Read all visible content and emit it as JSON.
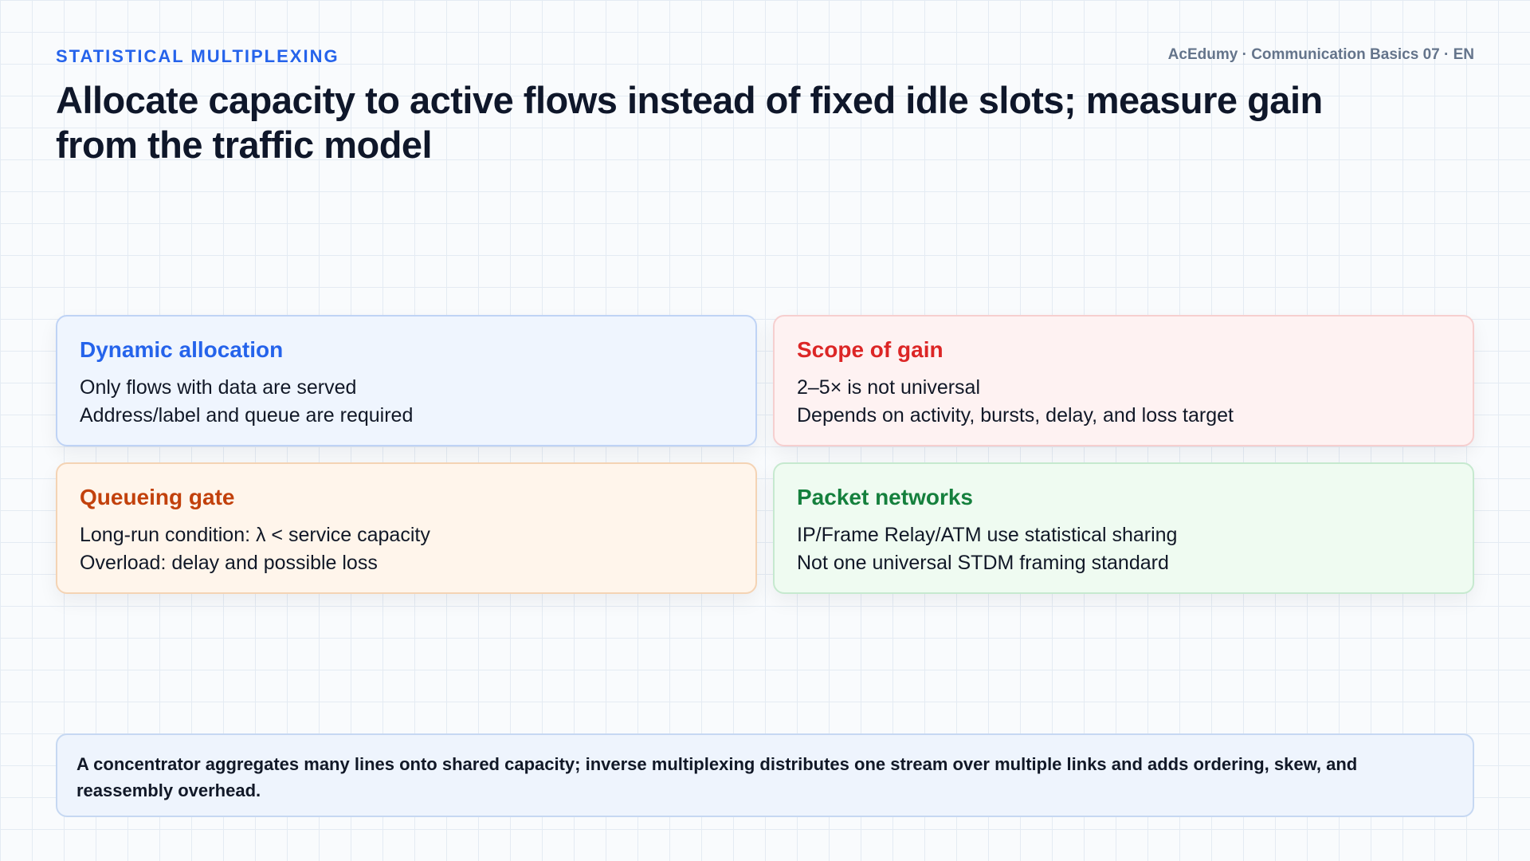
{
  "header": {
    "kicker": "STATISTICAL MULTIPLEXING",
    "meta": "AcEdumy · Communication Basics 07 · EN",
    "title": "Allocate capacity to active flows instead of fixed idle slots; measure gain from the traffic model"
  },
  "cards": [
    {
      "title": "Dynamic allocation",
      "lines": [
        "Only flows with data are served",
        "Address/label and queue are required"
      ],
      "accent": "#2563eb"
    },
    {
      "title": "Scope of gain",
      "lines": [
        "2–5× is not universal",
        "Depends on activity, bursts, delay, and loss target"
      ],
      "accent": "#dc2626"
    },
    {
      "title": "Queueing gate",
      "lines": [
        "Long-run condition: λ < service capacity",
        "Overload: delay and possible loss"
      ],
      "accent": "#c2410c"
    },
    {
      "title": "Packet networks",
      "lines": [
        "IP/Frame Relay/ATM use statistical sharing",
        "Not one universal STDM framing standard"
      ],
      "accent": "#15803d"
    }
  ],
  "note": {
    "text": "A concentrator aggregates many lines onto shared capacity; inverse multiplexing distributes one stream over multiple links and adds ordering, skew, and reassembly overhead."
  }
}
